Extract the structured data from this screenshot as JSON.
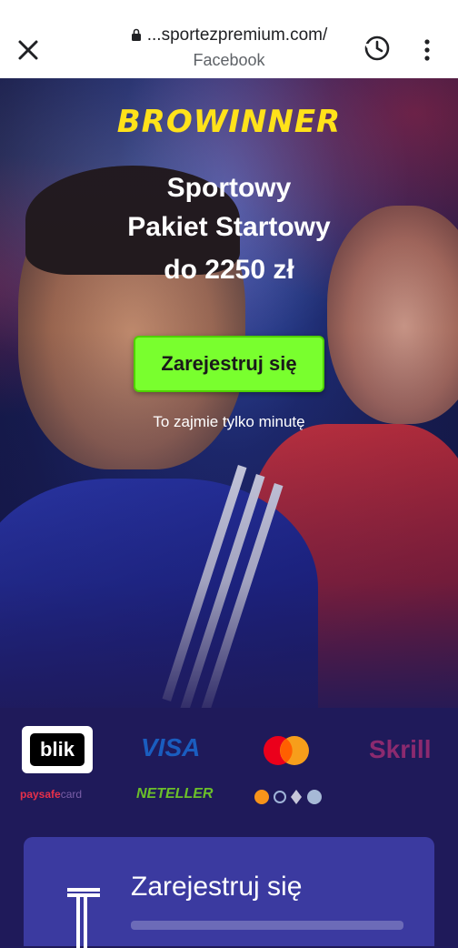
{
  "browser": {
    "url": "...sportezpremium.com/",
    "subtitle": "Facebook"
  },
  "hero": {
    "brand": "BROWINNER",
    "headline_line1": "Sportowy",
    "headline_line2": "Pakiet Startowy",
    "headline_line3": "do 2250 zł",
    "cta_label": "Zarejestruj się",
    "note": "To zajmie tylko minutę"
  },
  "payments": {
    "blik": "blik",
    "visa": "VISA",
    "skrill": "Skrill",
    "paysafe_a": "paysafe",
    "paysafe_b": "card",
    "neteller": "NETELLER"
  },
  "register_card": {
    "title": "Zarejestruj się"
  },
  "colors": {
    "accent_green": "#79ff2e",
    "brand_yellow": "#ffe21a",
    "page_bg": "#1f1a5a"
  }
}
